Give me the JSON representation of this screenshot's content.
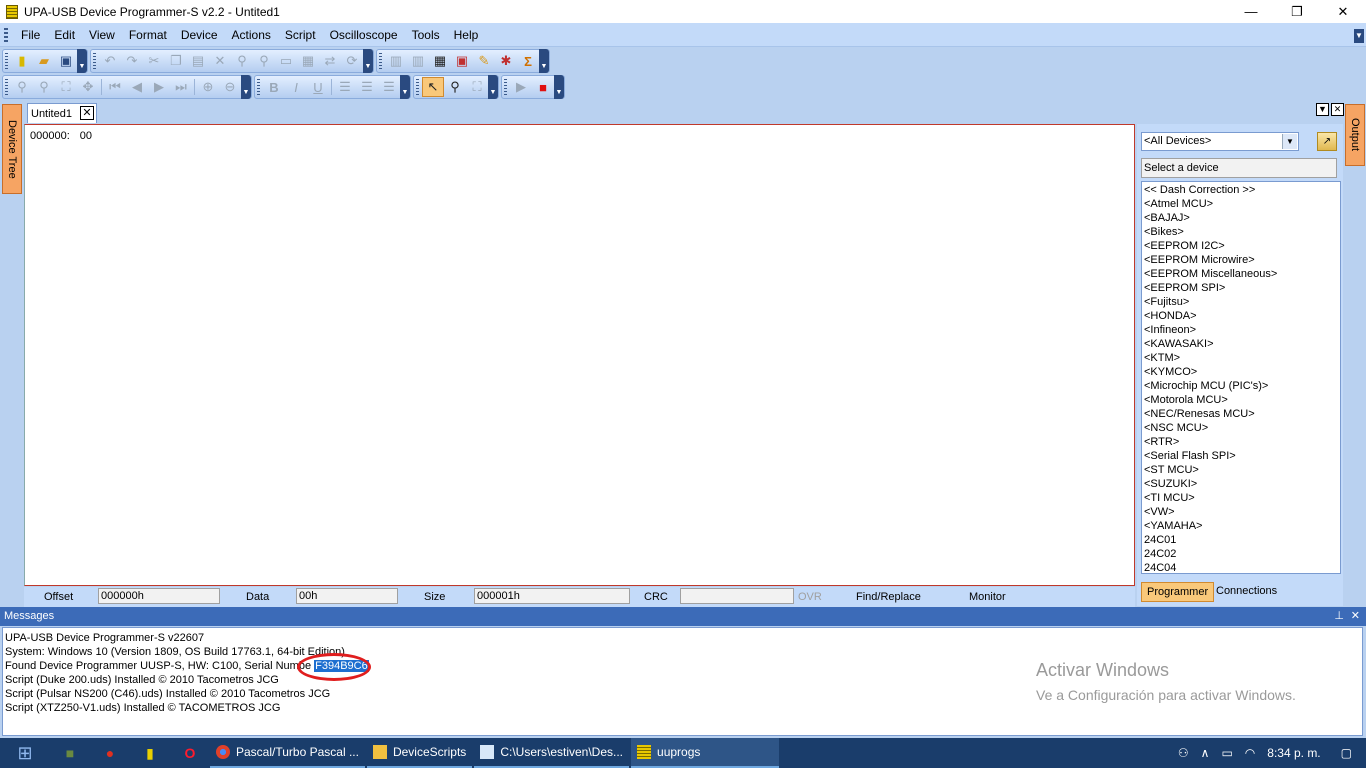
{
  "window": {
    "title": "UPA-USB Device Programmer-S v2.2 - Untited1",
    "controls": [
      "—",
      "❐",
      "✕"
    ]
  },
  "menu": [
    "File",
    "Edit",
    "View",
    "Format",
    "Device",
    "Actions",
    "Script",
    "Oscilloscope",
    "Tools",
    "Help"
  ],
  "side_tabs": {
    "left": "Device Tree",
    "right": "Output"
  },
  "document": {
    "tab": "Untited1",
    "hex_offset": "000000:",
    "hex_value": "00"
  },
  "status": {
    "offset_label": "Offset",
    "offset_value": "000000h",
    "data_label": "Data",
    "data_value": "00h",
    "size_label": "Size",
    "size_value": "000001h",
    "crc_label": "CRC",
    "crc_value": "",
    "ovr_label": "OVR",
    "find_label": "Find/Replace",
    "monitor_label": "Monitor"
  },
  "device_panel": {
    "filter_value": "<All Devices>",
    "select_label": "Select a device",
    "devices": [
      "<< Dash Correction >>",
      "<Atmel MCU>",
      "<BAJAJ>",
      "<Bikes>",
      "<EEPROM I2C>",
      "<EEPROM Microwire>",
      "<EEPROM Miscellaneous>",
      "<EEPROM SPI>",
      "<Fujitsu>",
      "<HONDA>",
      "<Infineon>",
      "<KAWASAKI>",
      "<KTM>",
      "<KYMCO>",
      "<Microchip MCU (PIC's)>",
      "<Motorola MCU>",
      "<NEC/Renesas MCU>",
      "<NSC MCU>",
      "<RTR>",
      "<Serial Flash SPI>",
      "<ST MCU>",
      "<SUZUKI>",
      "<TI MCU>",
      "<VW>",
      "<YAMAHA>",
      "24C01",
      "24C02",
      "24C04"
    ],
    "tabs": [
      "Programmer",
      "Connections"
    ]
  },
  "messages": {
    "title": "Messages",
    "lines": [
      "UPA-USB Device Programmer-S v22607",
      "System: Windows 10 (Version 1809, OS Build 17763.1, 64-bit Edition)",
      "Script (Duke 200.uds) Installed © 2010 Tacometros JCG",
      "Script (Pulsar NS200 (C46).uds) Installed © 2010 Tacometros JCG",
      "Script (XTZ250-V1.uds) Installed © TACOMETROS JCG"
    ],
    "found_prefix": "Found Device Programmer UUSP-S, HW: C100, Serial Numbe",
    "serial": "F394B9C6"
  },
  "watermark": {
    "line1": "Activar Windows",
    "line2": "Ve a Configuración para activar Windows."
  },
  "taskbar": {
    "tasks": [
      "Pascal/Turbo Pascal ...",
      "DeviceScripts",
      "C:\\Users\\estiven\\Des...",
      "uuprogs"
    ],
    "clock": "8:34 p. m."
  },
  "colors": {
    "titlebar": "#ffffff",
    "menubar": "#c3daf9",
    "messages_header": "#3c6bb8",
    "highlight": "#1e6fd0",
    "annotation_circle": "#e01e1e",
    "taskbar": "#1a3d6b"
  }
}
